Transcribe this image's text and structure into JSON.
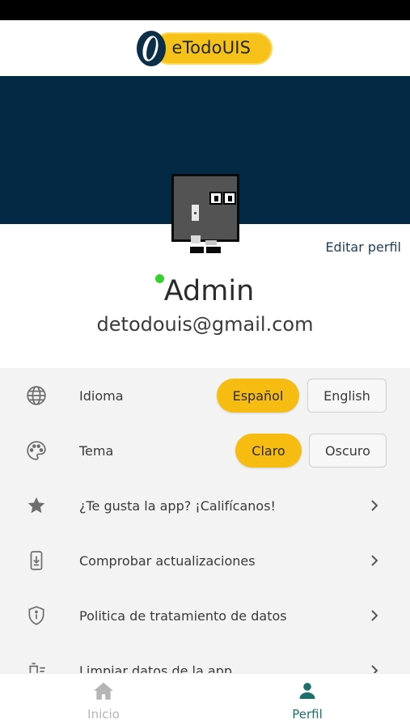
{
  "app": {
    "logo_text": "eTodoUIS"
  },
  "profile": {
    "edit_label": "Editar perfil",
    "name": "Admin",
    "email": "detodouis@gmail.com"
  },
  "settings": {
    "language": {
      "label": "Idioma",
      "options": [
        "Español",
        "English"
      ],
      "selected": "Español"
    },
    "theme": {
      "label": "Tema",
      "options": [
        "Claro",
        "Oscuro"
      ],
      "selected": "Claro"
    },
    "items": [
      {
        "label": "¿Te gusta la app? ¡Califícanos!",
        "icon": "star-icon"
      },
      {
        "label": "Comprobar actualizaciones",
        "icon": "phone-download-icon"
      },
      {
        "label": "Politica de tratamiento de datos",
        "icon": "shield-info-icon"
      },
      {
        "label": "Limpiar datos de la app",
        "icon": "delete-sweep-icon"
      }
    ]
  },
  "nav": {
    "inicio": "Inicio",
    "perfil": "Perfil",
    "active": "perfil"
  },
  "colors": {
    "banner": "#042944",
    "accent": "#f7bc12",
    "active_nav": "#1d6e6c",
    "online": "#36d12a"
  }
}
